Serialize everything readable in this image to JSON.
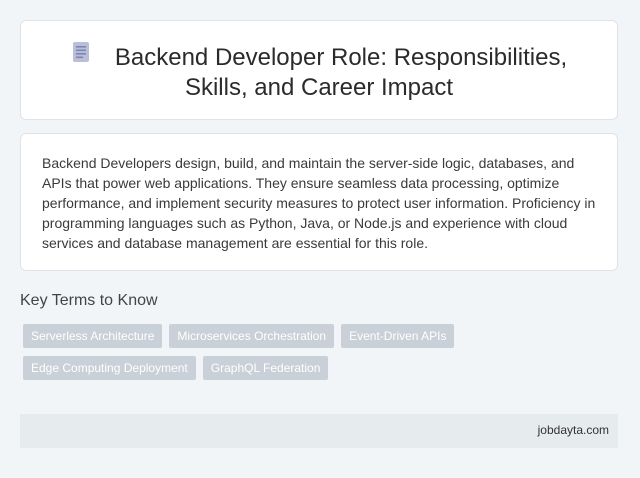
{
  "header": {
    "icon": "document-icon",
    "title_line1": "Backend Developer Role: Responsibilities,",
    "title_line2": "Skills, and Career Impact"
  },
  "summary": {
    "text": "Backend Developers design, build, and maintain the server-side logic, databases, and APIs that power web applications. They ensure seamless data processing, optimize performance, and implement security measures to protect user information. Proficiency in programming languages such as Python, Java, or Node.js and experience with cloud services and database management are essential for this role."
  },
  "key_terms": {
    "heading": "Key Terms to Know",
    "tags": [
      "Serverless Architecture",
      "Microservices Orchestration",
      "Event-Driven APIs",
      "Edge Computing Deployment",
      "GraphQL Federation"
    ]
  },
  "footer": {
    "site": "jobdayta.com"
  },
  "colors": {
    "background": "#f2f5f8",
    "tag_background": "#c9d0d8",
    "footer_background": "#e6ebee"
  }
}
